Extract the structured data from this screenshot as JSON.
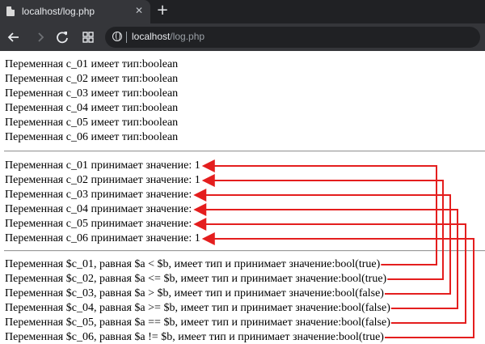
{
  "browser": {
    "tab_title": "localhost/log.php",
    "tab_close_label": "✕",
    "new_tab_label": "+",
    "url_host": "localhost",
    "url_path": "/log.php"
  },
  "colors": {
    "arrow": "#e41e1e",
    "chrome_dark": "#202124",
    "chrome_toolbar": "#35363a"
  },
  "icons": [
    "back-icon",
    "forward-icon",
    "reload-icon",
    "apps-icon",
    "globe-icon",
    "close-icon",
    "plus-icon",
    "page-favicon"
  ],
  "page": {
    "types": [
      "Переменная c_01 имеет тип:boolean",
      "Переменная c_02 имеет тип:boolean",
      "Переменная c_03 имеет тип:boolean",
      "Переменная c_04 имеет тип:boolean",
      "Переменная c_05 имеет тип:boolean",
      "Переменная c_06 имеет тип:boolean"
    ],
    "values": [
      "Переменная c_01 принимает значение: 1",
      "Переменная c_02 принимает значение: 1",
      "Переменная c_03 принимает значение:",
      "Переменная c_04 принимает значение:",
      "Переменная c_05 принимает значение:",
      "Переменная c_06 принимает значение: 1"
    ],
    "comparisons": [
      "Переменная $c_01, равная $a < $b, имеет тип и принимает значение:bool(true)",
      "Переменная $c_02, равная $a <= $b, имеет тип и принимает значение:bool(true)",
      "Переменная $c_03, равная $a > $b, имеет тип и принимает значение:bool(false)",
      "Переменная $c_04, равная $a >= $b, имеет тип и принимает значение:bool(false)",
      "Переменная $c_05, равная $a == $b, имеет тип и принимает значение:bool(false)",
      "Переменная $c_06, равная $a != $b, имеет тип и принимает значение:bool(true)"
    ]
  }
}
